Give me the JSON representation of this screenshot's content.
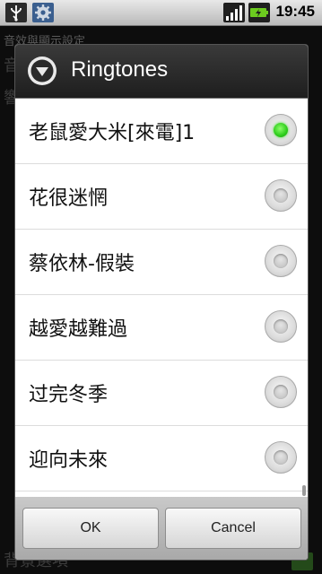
{
  "status_bar": {
    "time": "19:45",
    "icons": [
      "usb-icon",
      "settings-icon",
      "signal-icon",
      "battery-charging-icon"
    ]
  },
  "background": {
    "title": "音效與顯示設定",
    "items": [
      "音",
      "響鈴模式",
      "背景選項"
    ]
  },
  "dialog": {
    "title": "Ringtones",
    "title_icon": "dropdown-circle-icon",
    "options": [
      {
        "label": "老鼠愛大米[來電]1",
        "selected": true
      },
      {
        "label": "花很迷惘",
        "selected": false
      },
      {
        "label": "蔡依林-假裝",
        "selected": false
      },
      {
        "label": "越愛越難過",
        "selected": false
      },
      {
        "label": "过完冬季",
        "selected": false
      },
      {
        "label": "迎向未來",
        "selected": false
      }
    ],
    "ok_label": "OK",
    "cancel_label": "Cancel"
  },
  "colors": {
    "selected_radio": "#2ccc1a",
    "header_bg": "#2a2a2a",
    "button_bar_bg": "#b8b8b8"
  }
}
